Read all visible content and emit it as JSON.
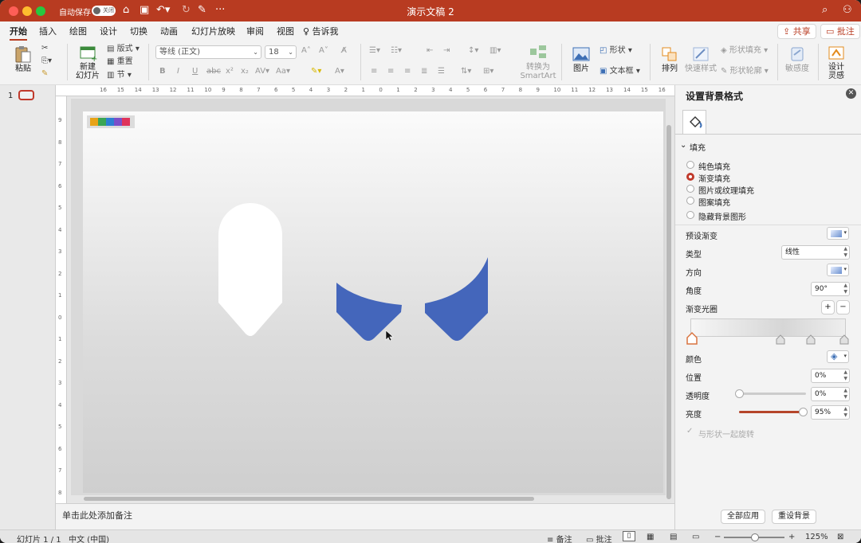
{
  "titlebar": {
    "autosave_label": "自动保存",
    "autosave_state": "关闭",
    "doc_title": "演示文稿 2"
  },
  "tabs": [
    "开始",
    "插入",
    "绘图",
    "设计",
    "切换",
    "动画",
    "幻灯片放映",
    "审阅",
    "视图"
  ],
  "tell_me": "告诉我",
  "share_label": "共享",
  "comments_label": "批注",
  "ribbon": {
    "paste": "粘贴",
    "new_slide": [
      "新建",
      "幻灯片"
    ],
    "layout": "版式",
    "reset": "重置",
    "section": "节",
    "font_name": "等线 (正文)",
    "font_size": "18",
    "smartart": [
      "转换为",
      "SmartArt"
    ],
    "picture": "图片",
    "shape": "形状",
    "textbox": "文本框",
    "arrange": "排列",
    "quick_styles": "快速样式",
    "shape_fill": "形状填充",
    "shape_outline": "形状轮廓",
    "sensitivity": "敏感度",
    "design_ideas": [
      "设计",
      "灵感"
    ]
  },
  "thumb_number": "1",
  "rulers": {
    "h": [
      "16",
      "15",
      "14",
      "13",
      "12",
      "11",
      "10",
      "9",
      "8",
      "7",
      "6",
      "5",
      "4",
      "3",
      "2",
      "1",
      "0",
      "1",
      "2",
      "3",
      "4",
      "5",
      "6",
      "7",
      "8",
      "9",
      "10",
      "11",
      "12",
      "13",
      "14",
      "15",
      "16"
    ],
    "v": [
      "9",
      "8",
      "7",
      "6",
      "5",
      "4",
      "3",
      "2",
      "1",
      "0",
      "1",
      "2",
      "3",
      "4",
      "5",
      "6",
      "7",
      "8",
      "9"
    ]
  },
  "notes_placeholder": "单击此处添加备注",
  "colors": {
    "accent": "#b83b21",
    "shape_blue": "#4466bb",
    "shape_white": "#ffffff"
  },
  "palette": [
    "#e8a317",
    "#3aa655",
    "#2d7fd3",
    "#7b4fc9",
    "#e0335a"
  ],
  "panel": {
    "title": "设置背景格式",
    "fill_section": "填充",
    "fill_options": [
      "纯色填充",
      "渐变填充",
      "图片或纹理填充",
      "图案填充"
    ],
    "fill_selected": 1,
    "hide_bg": "隐藏背景图形",
    "preset_label": "预设渐变",
    "type_label": "类型",
    "type_value": "线性",
    "direction_label": "方向",
    "angle_label": "角度",
    "angle_value": "90°",
    "stops_label": "渐变光圈",
    "color_label": "颜色",
    "position_label": "位置",
    "position_value": "0%",
    "transparency_label": "透明度",
    "transparency_value": "0%",
    "transparency_level": 0,
    "brightness_label": "亮度",
    "brightness_value": "95%",
    "brightness_level": 0.95,
    "rotate_label": "与形状一起旋转",
    "apply_all": "全部应用",
    "reset_bg": "重设背景"
  },
  "status": {
    "slide": "幻灯片 1 / 1",
    "lang": "中文 (中国)",
    "notes": "备注",
    "comments": "批注",
    "zoom": "125%"
  }
}
